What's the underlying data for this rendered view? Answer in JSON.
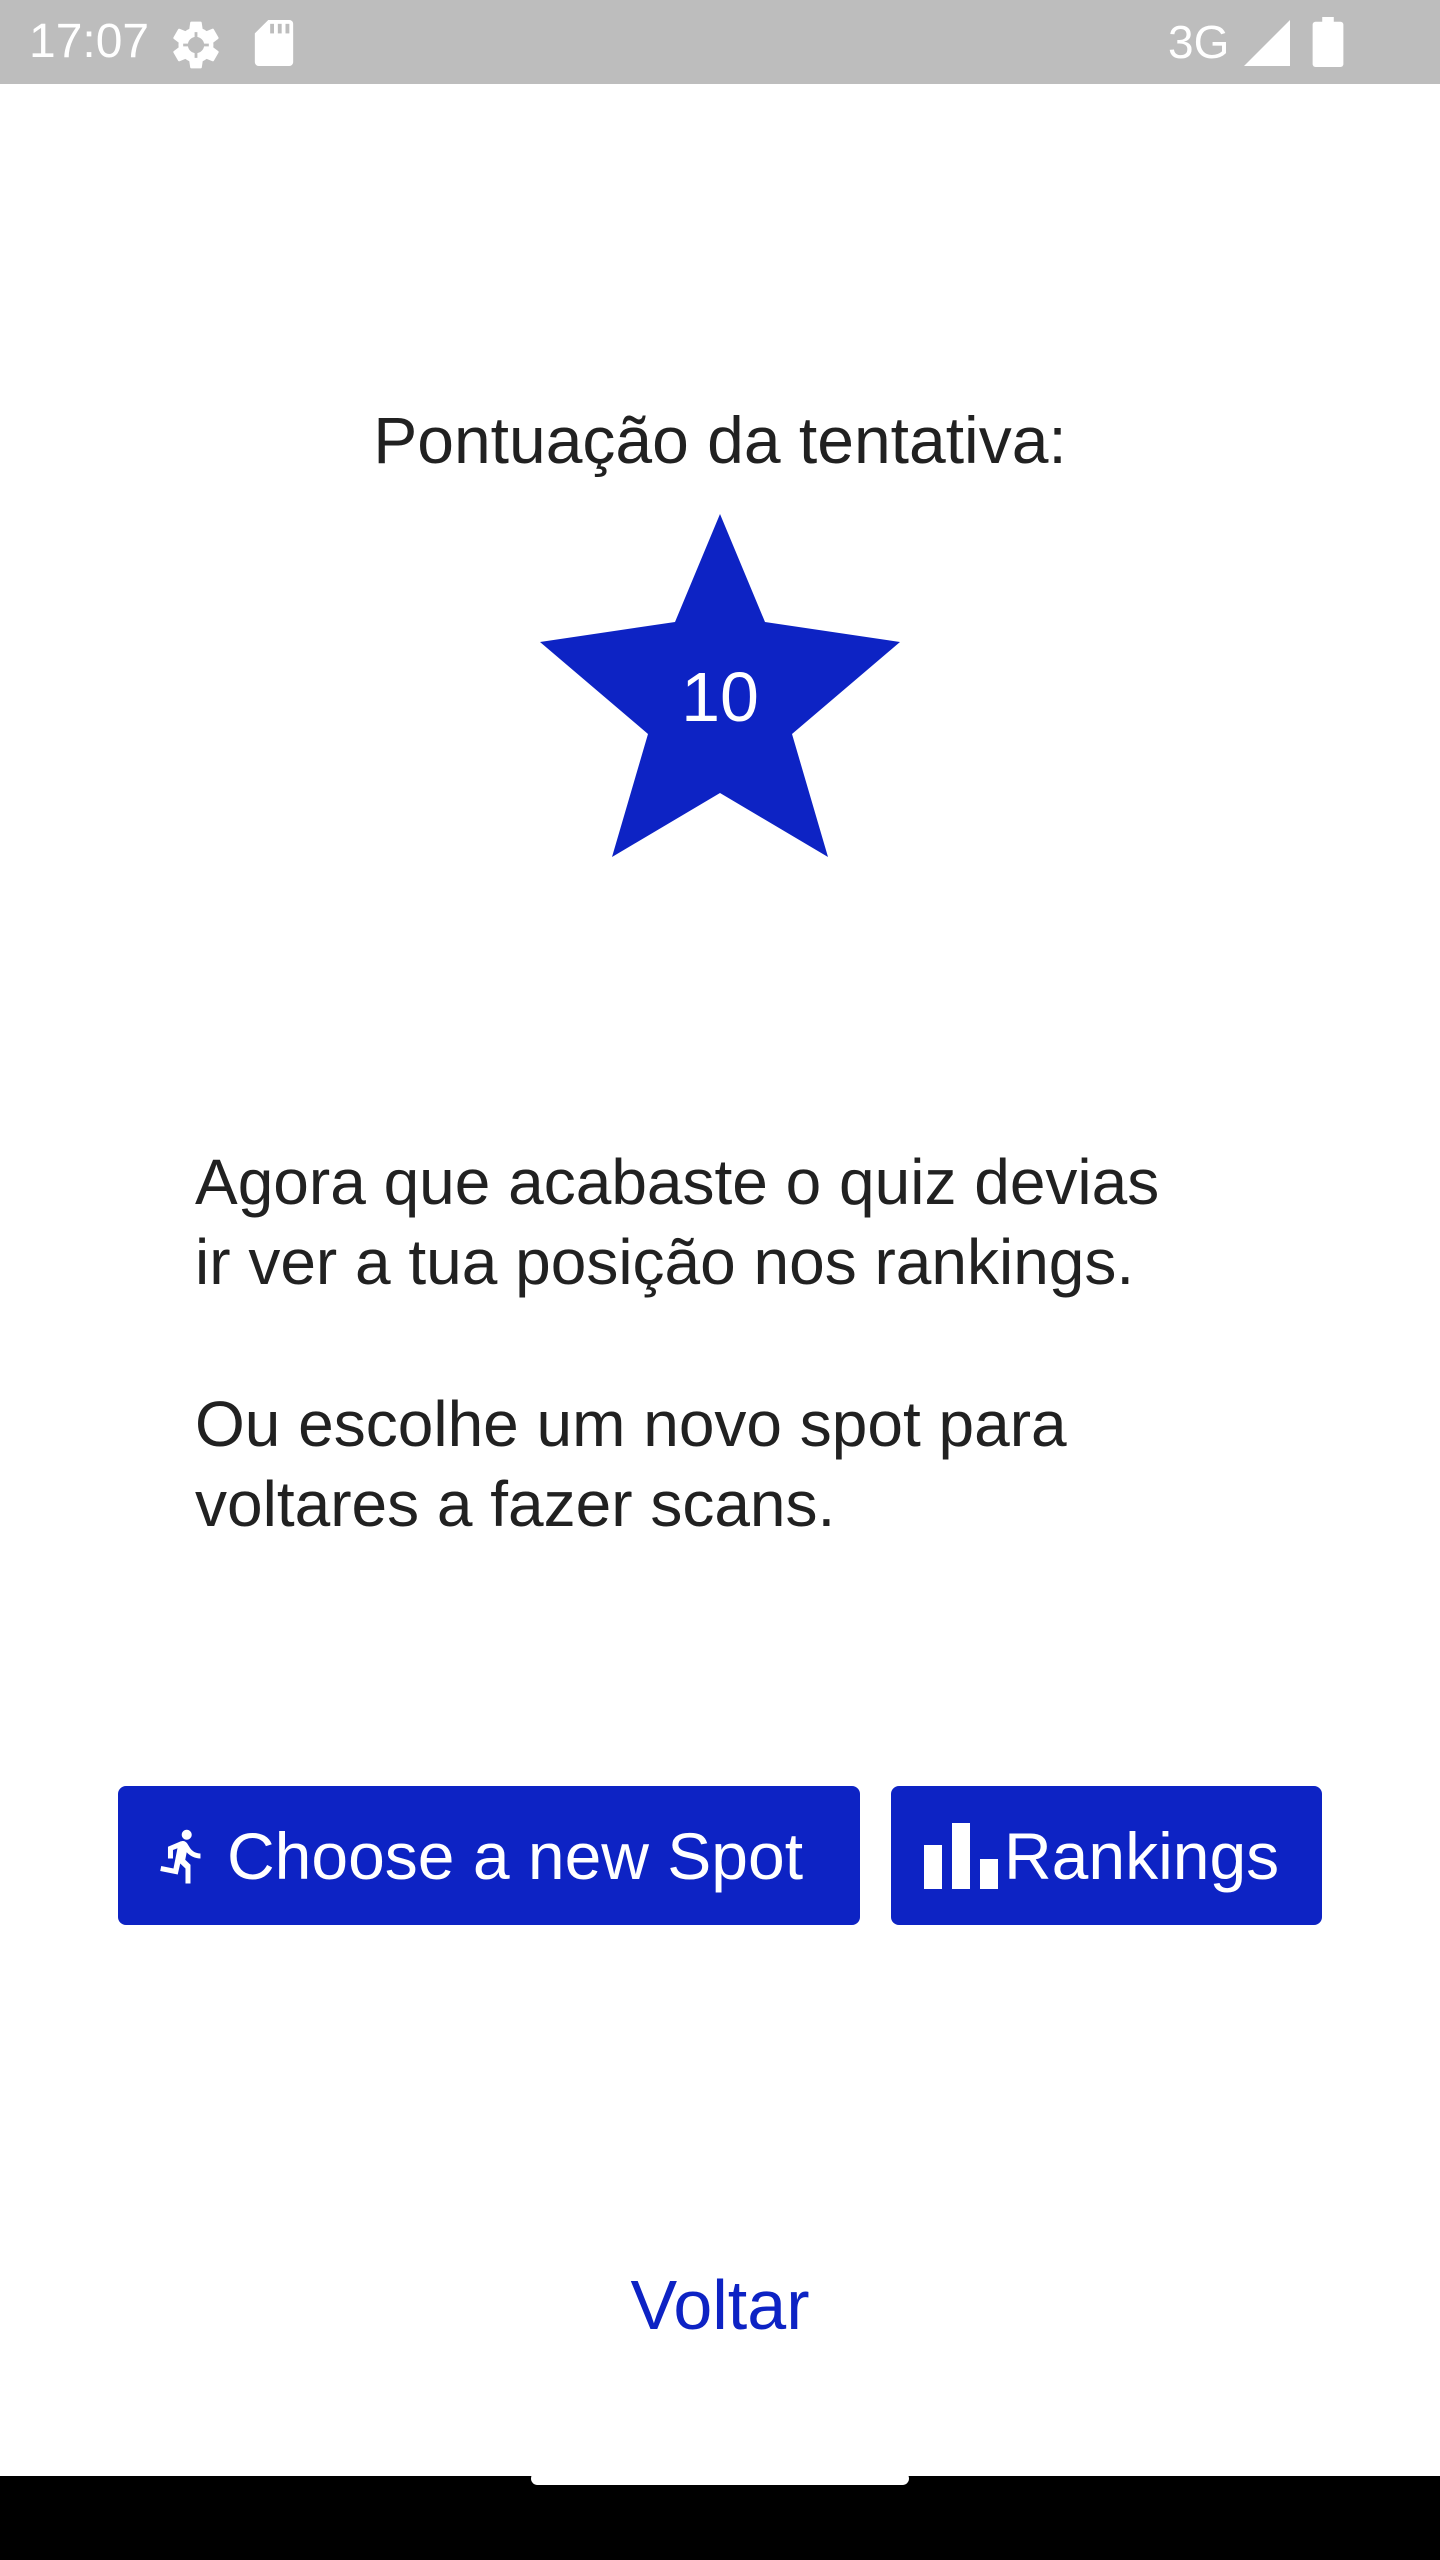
{
  "status_bar": {
    "time": "17:07",
    "network": "3G",
    "icons": [
      "settings-gear-icon",
      "sd-card-icon",
      "cell-signal-icon",
      "battery-icon"
    ]
  },
  "score": {
    "title": "Pontuação da tentativa:",
    "value": "10",
    "star_color": "#0d23c4"
  },
  "messages": {
    "line1": "Agora que acabaste o quiz devias\nir ver a tua posição nos rankings.",
    "line2": "Ou escolhe um novo spot para\nvoltares a fazer scans."
  },
  "actions": {
    "choose_spot_label": "Choose a new Spot",
    "choose_spot_icon": "running-person-icon",
    "rankings_label": "Rankings",
    "rankings_icon": "bar-chart-icon",
    "button_color": "#0d23c4"
  },
  "back": {
    "label": "Voltar"
  }
}
